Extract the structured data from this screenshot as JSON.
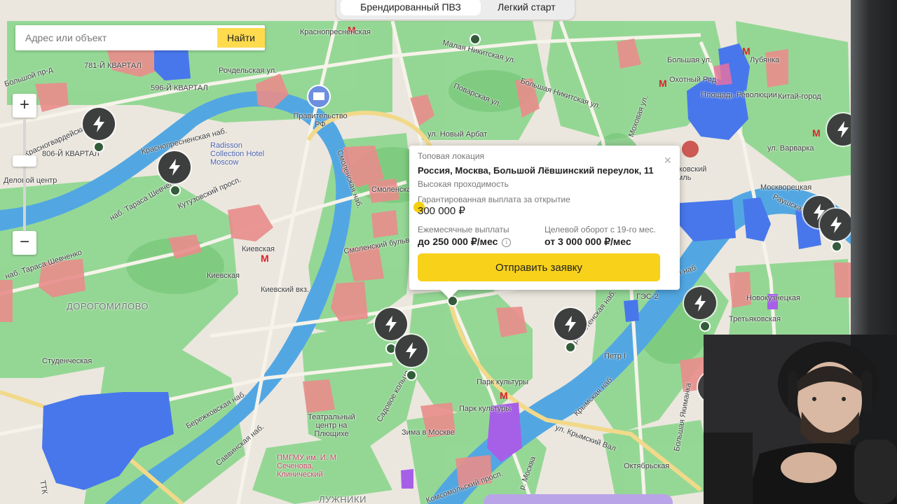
{
  "tabs": [
    {
      "label": "Брендированный ПВЗ"
    },
    {
      "label": "Легкий старт"
    }
  ],
  "search": {
    "placeholder": "Адрес или объект",
    "button_label": "Найти"
  },
  "zoom": {
    "in_label": "+",
    "out_label": "−"
  },
  "map_labels": {
    "krasnopresnenskaya": "Краснопресненская",
    "b_presnensky": "Большой пр-д",
    "kvartal_781": "781-Й КВАРТАЛ",
    "kvartal_596": "596-Й КВАРТАЛ",
    "rochdelskaya": "Рочдельская ул.",
    "bolshaya_nikitskaya": "Большая Никитская ул.",
    "malaya_nikitskaya": "Малая Никитская ул.",
    "povarskaya": "Поварская ул.",
    "bolshaya_polyanka": "Большая ул.",
    "okhotny_ryad": "Охотный Ряд",
    "ploshchad_revolyutsii": "Площадь Революции",
    "kitay_gorod": "Китай-город",
    "lubyanka": "Лубянка",
    "ulitsa_varvarka": "ул. Варварка",
    "pravitelstvo": "Правительство РФ",
    "radisson": "Radisson Collection Hotel Moscow",
    "krasnogvard": "Красногвардейский пр-д",
    "kvartal_806": "806-Й КВАРТАЛ",
    "kvartal_snd": "-Й КВАРТАЛ",
    "delovoy_tsentr": "Деловой центр",
    "krasnopresnenskaya_nab": "Краснопресненская наб.",
    "kutuzovsky": "Кутузовский просп.",
    "tarasa_shevchenko": "наб. Тараса Шевченко",
    "tarasa_shevchenko2": "наб. Тараса Шевченко",
    "kievskaya": "Киевская",
    "kievskaya2": "Киевская",
    "kievsky_vokzal": "Киевский вкз.",
    "dorogomilovo": "ДОРОГОМИЛОВО",
    "studencheskaya": "Студенческая",
    "berezhkovskaya": "Бережковская наб.",
    "savvinskaya": "Саввинская наб.",
    "novy_arbat": "ул. Новый Арбат",
    "smolenskaya": "Смоленская",
    "smolenskaya_nab": "Смоленская наб.",
    "teatr": "Театральный центр на Плющихе",
    "pmgmu": "ПМГМУ им. И. М. Сеченова, Клинический",
    "park_kultury": "Парк культуры",
    "park_kultury2": "Парк культуры",
    "zima": "Зима в Москве",
    "prechistenskaya": "Пречистенская наб.",
    "krymsky_val": "ул. Крымский Вал",
    "krymskaya_nab": "Крымская наб.",
    "b_yakimanka": "Большая Якиманка",
    "oktyabrskaya": "Октябрьская",
    "tretyakovskaya": "Третьяковская",
    "novokuznetskaya": "Новокузнецкая",
    "moskvoretskaya": "Москворецкая",
    "raushskaya": "Раушская наб.",
    "moskovsky_kreml": "Московский Кремль",
    "ges2": "ГЭС-2",
    "petr1": "Петр I",
    "kadashevskaya": "Кадашевская наб.",
    "moskva_river": "р. Москва",
    "ttk": "ТТК",
    "komsomolsky": "Комсомольский просп.",
    "luzhniki": "ЛУЖНИКИ",
    "sadovoe": "Садовое кольцо",
    "mokhovaya": "Моховая ул.",
    "smolensky_bulv": "Смоленский бульв."
  },
  "popup": {
    "category": "Топовая локация",
    "address": "Россия, Москва, Большой Лёвшинский переулок, 11",
    "traffic": "Высокая проходимость",
    "guaranteed_label": "Гарантированная выплата за открытие",
    "guaranteed_value": "300 000 ₽",
    "monthly_label": "Ежемесячные выплаты",
    "monthly_value": "до 250 000 ₽/мес",
    "info_icon": "i",
    "turnover_label": "Целевой оборот с 19-го мес.",
    "turnover_value": "от 3 000 000 ₽/мес",
    "close_label": "×",
    "cta_label": "Отправить заявку"
  },
  "colors": {
    "accent": "#f7d11a",
    "park": "#8fd891",
    "river": "#4aa3e0",
    "zone_red": "#e88a8a",
    "zone_blue": "#4a7df0",
    "zone_purple": "#a565e6",
    "pin": "#3d3f3e"
  },
  "icons": [
    "lightning-icon",
    "metro-icon",
    "hotel-icon",
    "government-icon",
    "info-icon",
    "close-icon",
    "zoom-in-icon",
    "zoom-out-icon"
  ]
}
